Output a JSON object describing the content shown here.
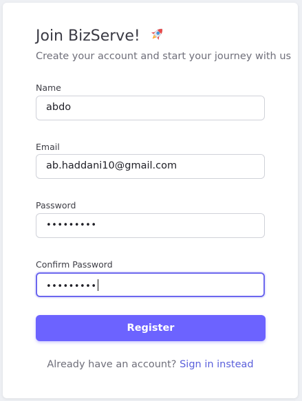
{
  "header": {
    "title": "Join BizServe!",
    "title_icon": "rocket-icon",
    "subtitle": "Create your account and start your journey with us"
  },
  "form": {
    "name": {
      "label": "Name",
      "value": "abdo"
    },
    "email": {
      "label": "Email",
      "value": "ab.haddani10@gmail.com"
    },
    "password": {
      "label": "Password",
      "value": "•••••••••"
    },
    "confirm_password": {
      "label": "Confirm Password",
      "value": "•••••••••"
    },
    "register_label": "Register"
  },
  "footer": {
    "prompt": "Already have an account?",
    "link_label": "Sign in instead"
  },
  "colors": {
    "accent": "#6c63ff",
    "link": "#5a5fdb",
    "focus_border": "#6b66ee"
  }
}
